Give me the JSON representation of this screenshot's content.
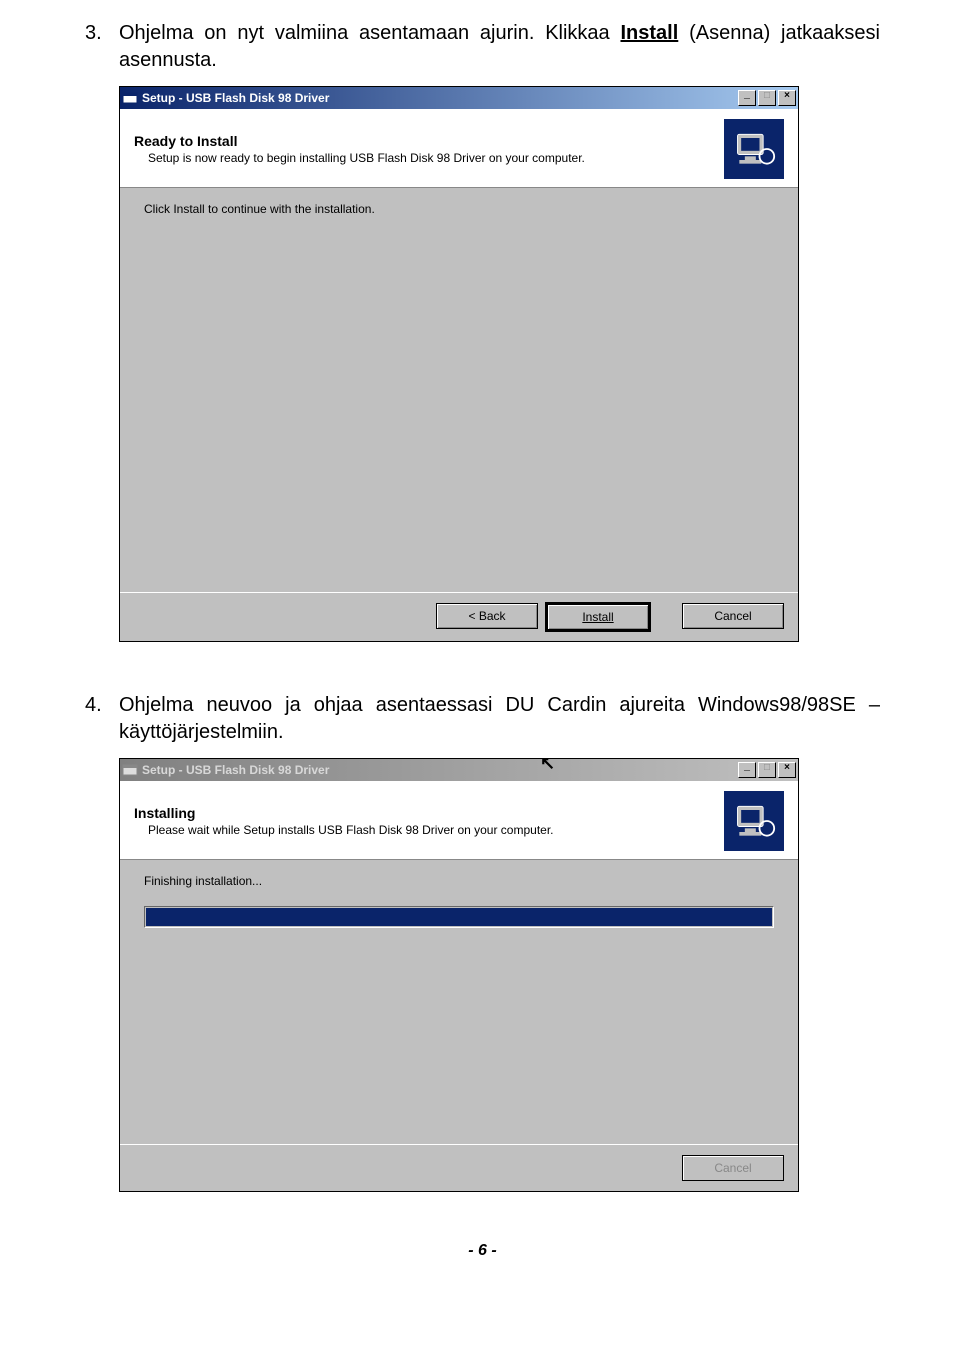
{
  "step3": {
    "num": "3.",
    "text_before": "Ohjelma on nyt valmiina asentamaan ajurin. Klikkaa ",
    "text_link": "Install",
    "text_after": " (Asenna) jatkaaksesi asennusta."
  },
  "win1": {
    "title": "Setup - USB Flash Disk 98 Driver",
    "header_main": "Ready to Install",
    "header_sub": "Setup is now ready to begin installing USB Flash Disk 98 Driver on your computer.",
    "body_line": "Click Install to continue with the installation.",
    "btn_back": "< Back",
    "btn_install": "Install",
    "btn_cancel": "Cancel"
  },
  "step4": {
    "num": "4.",
    "text": "Ohjelma neuvoo ja ohjaa asentaessasi DU Cardin ajureita Windows98/98SE –käyttöjärjestelmiin."
  },
  "win2": {
    "title": "Setup - USB Flash Disk 98 Driver",
    "header_main": "Installing",
    "header_sub": "Please wait while Setup installs USB Flash Disk 98 Driver on your computer.",
    "body_line": "Finishing installation...",
    "btn_cancel": "Cancel"
  },
  "page_num": "- 6 -"
}
